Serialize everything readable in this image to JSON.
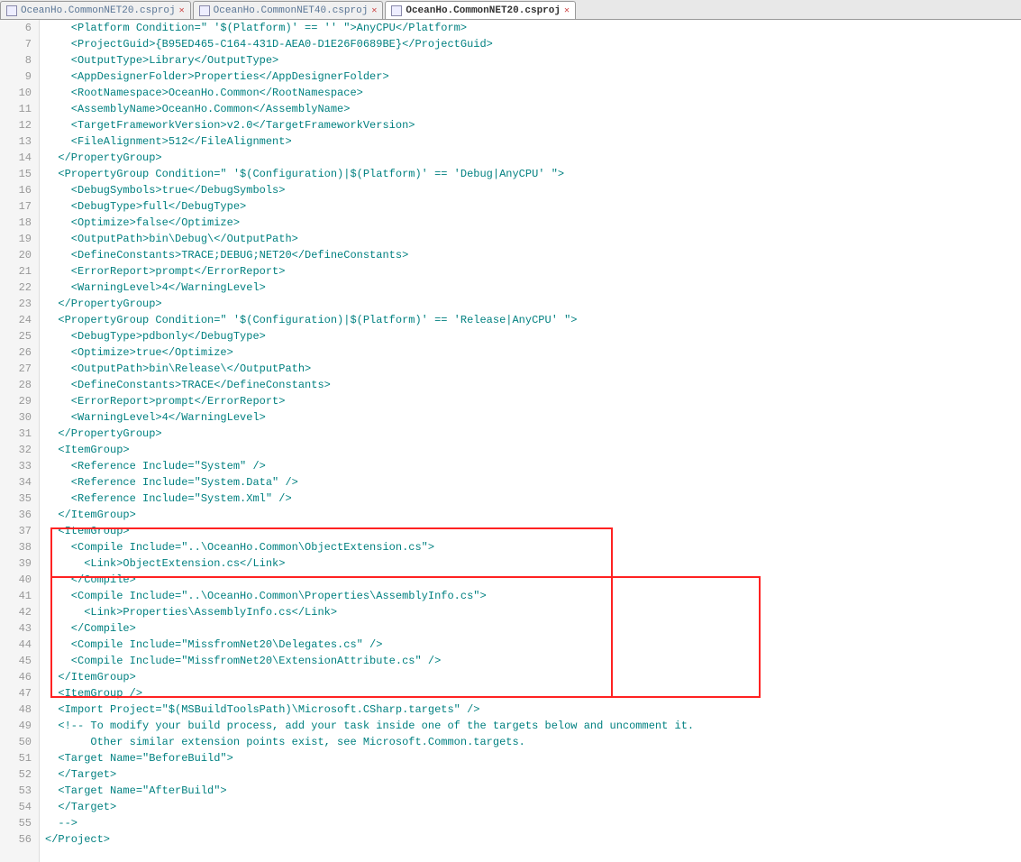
{
  "tabs": [
    {
      "label": "OceanHo.CommonNET20.csproj",
      "active": false
    },
    {
      "label": "OceanHo.CommonNET40.csproj",
      "active": false
    },
    {
      "label": "OceanHo.CommonNET20.csproj",
      "active": true
    }
  ],
  "gutter": {
    "start": 6,
    "end": 56
  },
  "code": [
    "    <Platform Condition=\" '$(Platform)' == '' \">AnyCPU</Platform>",
    "    <ProjectGuid>{B95ED465-C164-431D-AEA0-D1E26F0689BE}</ProjectGuid>",
    "    <OutputType>Library</OutputType>",
    "    <AppDesignerFolder>Properties</AppDesignerFolder>",
    "    <RootNamespace>OceanHo.Common</RootNamespace>",
    "    <AssemblyName>OceanHo.Common</AssemblyName>",
    "    <TargetFrameworkVersion>v2.0</TargetFrameworkVersion>",
    "    <FileAlignment>512</FileAlignment>",
    "  </PropertyGroup>",
    "  <PropertyGroup Condition=\" '$(Configuration)|$(Platform)' == 'Debug|AnyCPU' \">",
    "    <DebugSymbols>true</DebugSymbols>",
    "    <DebugType>full</DebugType>",
    "    <Optimize>false</Optimize>",
    "    <OutputPath>bin\\Debug\\</OutputPath>",
    "    <DefineConstants>TRACE;DEBUG;NET20</DefineConstants>",
    "    <ErrorReport>prompt</ErrorReport>",
    "    <WarningLevel>4</WarningLevel>",
    "  </PropertyGroup>",
    "  <PropertyGroup Condition=\" '$(Configuration)|$(Platform)' == 'Release|AnyCPU' \">",
    "    <DebugType>pdbonly</DebugType>",
    "    <Optimize>true</Optimize>",
    "    <OutputPath>bin\\Release\\</OutputPath>",
    "    <DefineConstants>TRACE</DefineConstants>",
    "    <ErrorReport>prompt</ErrorReport>",
    "    <WarningLevel>4</WarningLevel>",
    "  </PropertyGroup>",
    "  <ItemGroup>",
    "    <Reference Include=\"System\" />",
    "    <Reference Include=\"System.Data\" />",
    "    <Reference Include=\"System.Xml\" />",
    "  </ItemGroup>",
    "  <ItemGroup>",
    "    <Compile Include=\"..\\OceanHo.Common\\ObjectExtension.cs\">",
    "      <Link>ObjectExtension.cs</Link>",
    "    </Compile>",
    "    <Compile Include=\"..\\OceanHo.Common\\Properties\\AssemblyInfo.cs\">",
    "      <Link>Properties\\AssemblyInfo.cs</Link>",
    "    </Compile>",
    "    <Compile Include=\"MissfromNet20\\Delegates.cs\" />",
    "    <Compile Include=\"MissfromNet20\\ExtensionAttribute.cs\" />",
    "  </ItemGroup>",
    "  <ItemGroup />",
    "  <Import Project=\"$(MSBuildToolsPath)\\Microsoft.CSharp.targets\" />",
    "  <!-- To modify your build process, add your task inside one of the targets below and uncomment it.",
    "       Other similar extension points exist, see Microsoft.Common.targets.",
    "  <Target Name=\"BeforeBuild\">",
    "  </Target>",
    "  <Target Name=\"AfterBuild\">",
    "  </Target>",
    "  -->",
    "</Project>"
  ]
}
